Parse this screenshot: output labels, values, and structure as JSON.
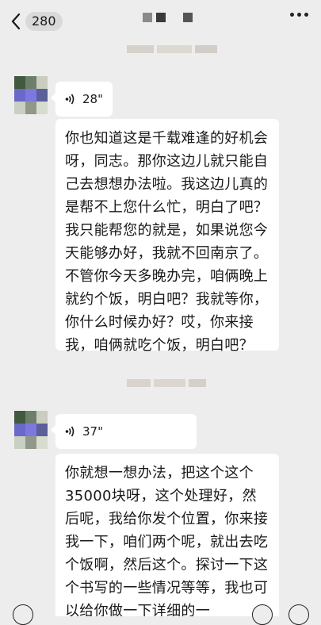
{
  "header": {
    "unread_count": "280",
    "icons": {
      "back": "chevron-left-icon",
      "more": "more-dots-icon"
    }
  },
  "messages": [
    {
      "type": "voice",
      "duration": "28\"",
      "transcript": "你也知道这是千载难逢的好机会呀，同志。那你这边儿就只能自己去想想办法啦。我这边儿真的是帮不上您什么忙，明白了吧？我只能帮您的就是，如果说您今天能够办好，我就不回南京了。不管你今天多晚办完，咱俩晚上就约个饭，明白吧？我就等你，你什么时候办好？哎，你来接我，咱俩就吃个饭，明白吧？"
    },
    {
      "type": "voice",
      "duration": "37\"",
      "transcript": "你就想一想办法，把这个这个35000块呀，这个处理好，然后呢，我给你发个位置，你来接我一下，咱们两个呢，就出去吃个饭啊，然后这个。探讨一下这个书写的一些情况等等，我也可以给你做一下详细的一"
    }
  ],
  "colors": {
    "background": "#ededed",
    "bubble": "#ffffff",
    "text": "#191919"
  }
}
